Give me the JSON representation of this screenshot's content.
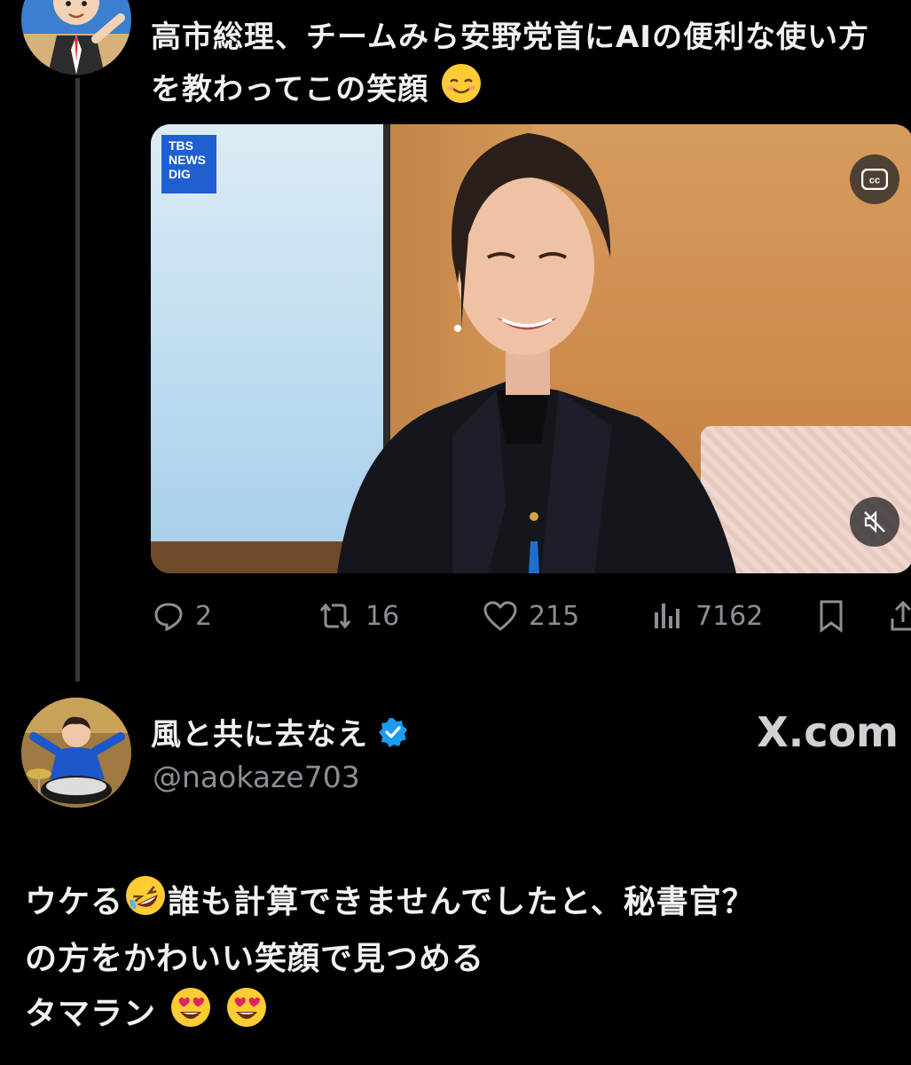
{
  "tweet1": {
    "text_line1": "高市総理、チームみら安野党首にAIの便利な使い方",
    "text_line2": "を教わってこの笑顔",
    "text_emoji": "relieved-face",
    "media": {
      "logo": "TBS NEWS DIG",
      "cc_icon": "cc-icon",
      "mute_icon": "mute-icon"
    },
    "actions": {
      "replies": "2",
      "reposts": "16",
      "likes": "215",
      "views": "7162"
    }
  },
  "tweet2": {
    "display_name": "風と共に去なえ",
    "handle": "@naokaze703",
    "verified": true,
    "watermark": "X.com",
    "body_line1": "ウケる",
    "body_line1_rest": "誰も計算できませんでしたと、秘書官？",
    "body_line2": "の方をかわいい笑顔で見つめる",
    "body_line3": "タマラン"
  },
  "colors": {
    "background": "#000000",
    "text": "#f1f1f1",
    "muted": "#8b8f95",
    "verified": "#1d9bf0"
  }
}
